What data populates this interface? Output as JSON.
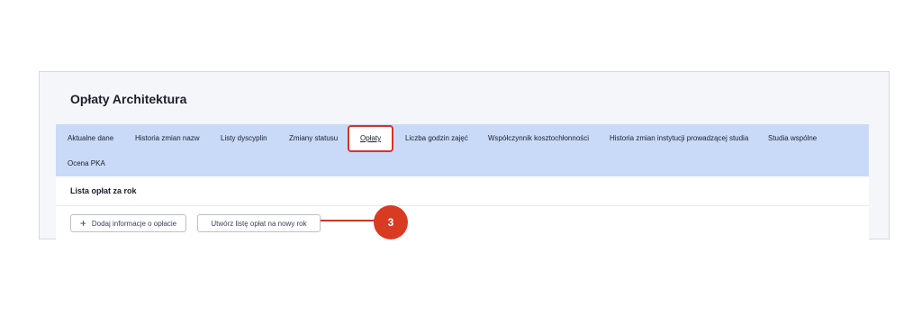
{
  "page": {
    "title": "Opłaty Architektura"
  },
  "tabs": [
    {
      "label": "Aktualne dane"
    },
    {
      "label": "Historia zmian nazw"
    },
    {
      "label": "Listy dyscyplin"
    },
    {
      "label": "Zmiany statusu"
    },
    {
      "label": "Opłaty",
      "active": true
    },
    {
      "label": "Liczba godzin zajęć"
    },
    {
      "label": "Współczynnik kosztochłonności"
    },
    {
      "label": "Historia zmian instytucji prowadzącej studia"
    },
    {
      "label": "Studia wspólne"
    },
    {
      "label": "Ocena PKA"
    }
  ],
  "section": {
    "title": "Lista opłat za rok",
    "add_button": "Dodaj informacje o opłacie",
    "create_button": "Utwórz listę opłat na nowy rok"
  },
  "callout": {
    "number": "3",
    "color": "#d93a22"
  },
  "colors": {
    "tabs_bg": "#c9daf8",
    "highlight": "#d1352a"
  }
}
